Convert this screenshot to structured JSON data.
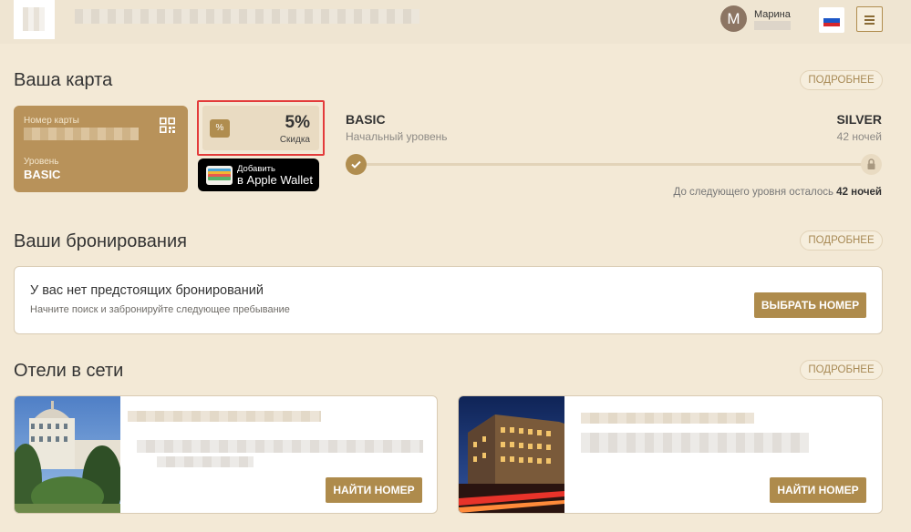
{
  "header": {
    "user_initial": "М",
    "user_name": "Марина",
    "flag_colors": [
      "#ffffff",
      "#1c57c7",
      "#d6262b"
    ],
    "menu_icon": "hamburger-icon"
  },
  "card_section": {
    "title": "Ваша карта",
    "more_label": "ПОДРОБНЕЕ",
    "card_number_label": "Номер карты",
    "level_label": "Уровень",
    "level_value": "BASIC",
    "qr_icon": "qr-code-icon",
    "discount_icon_text": "%",
    "discount_value": "5%",
    "discount_label": "Скидка",
    "wallet_line1": "Добавить",
    "wallet_line2": "в Apple Wallet",
    "current_tier": "BASIC",
    "current_tier_sub": "Начальный уровень",
    "next_tier": "SILVER",
    "next_tier_sub": "42 ночей",
    "remaining_text": "До следующего уровня осталось",
    "remaining_value": "42 ночей",
    "progress_fraction": 0
  },
  "bookings": {
    "title": "Ваши бронирования",
    "more_label": "ПОДРОБНЕЕ",
    "empty_title": "У вас нет предстоящих бронирований",
    "empty_sub": "Начните поиск и забронируйте следующее пребывание",
    "choose_button": "ВЫБРАТЬ НОМЕР"
  },
  "hotels": {
    "title": "Отели в сети",
    "more_label": "ПОДРОБНЕЕ",
    "items": [
      {
        "button": "НАЙТИ НОМЕР"
      },
      {
        "button": "НАЙТИ НОМЕР"
      }
    ]
  },
  "colors": {
    "accent": "#ae8b4c",
    "background": "#f3e9d6",
    "highlight_border": "#e33b3b"
  }
}
